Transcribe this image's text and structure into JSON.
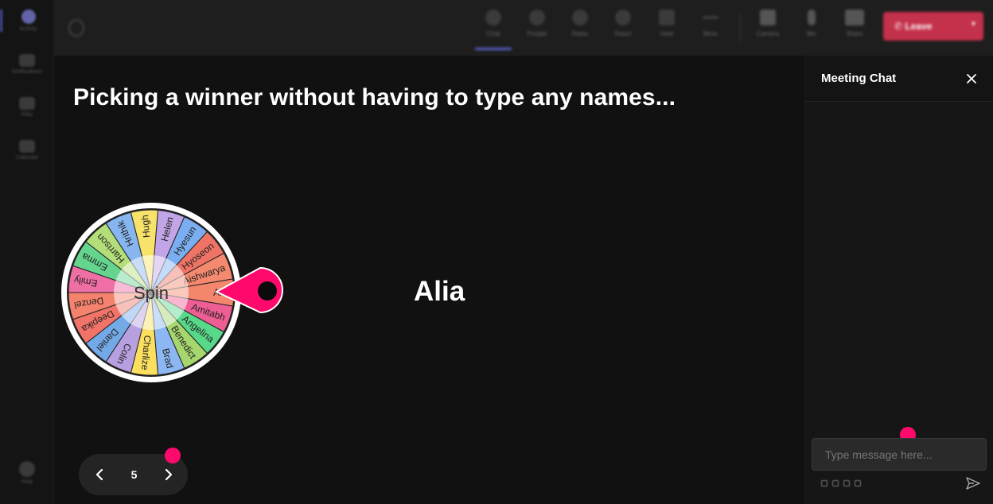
{
  "rail": {
    "items": [
      {
        "label": "Activity",
        "icon": "bell-icon"
      },
      {
        "label": "Notifications",
        "icon": "chat-icon"
      },
      {
        "label": "Files",
        "icon": "file-icon"
      },
      {
        "label": "Calendar",
        "icon": "calendar-icon"
      },
      {
        "label": "Help",
        "icon": "help-icon"
      }
    ]
  },
  "toolbar": {
    "buttons": [
      {
        "label": "Chat",
        "icon": "chat-bubble-icon"
      },
      {
        "label": "People",
        "icon": "people-icon"
      },
      {
        "label": "Raise",
        "icon": "hand-icon"
      },
      {
        "label": "React",
        "icon": "smile-icon"
      },
      {
        "label": "View",
        "icon": "grid-icon"
      },
      {
        "label": "More",
        "icon": "ellipsis-icon"
      },
      {
        "label": "Camera",
        "icon": "camera-icon"
      },
      {
        "label": "Mic",
        "icon": "mic-icon"
      },
      {
        "label": "Share",
        "icon": "share-icon"
      }
    ],
    "leave_label": "Leave",
    "leave_color": "#c4314b"
  },
  "stage": {
    "title": "Picking a winner without having to type any names...",
    "winner": "Alia",
    "wheel": {
      "center_label": "Spin",
      "names": [
        "Alia",
        "Amitabh",
        "Angelina",
        "Benedict",
        "Brad",
        "Charlize",
        "Colin",
        "Daniel",
        "Deepika",
        "Denzel",
        "Emily",
        "Emma",
        "Harrison",
        "Hrithik",
        "Hugh",
        "Helen",
        "Hyesun",
        "Hyoseon",
        "Aishwarya"
      ],
      "colors": [
        "#f4866d",
        "#ee5d93",
        "#58d889",
        "#a6d66e",
        "#8cb7f2",
        "#fbe060",
        "#b7a0e0",
        "#74a9e8",
        "#f27468",
        "#f5826c",
        "#ef6ea4",
        "#65d48e",
        "#b3de79",
        "#86b5ef",
        "#f7e36a",
        "#c1a5e6",
        "#7aaef0",
        "#f07466",
        "#f5896f"
      ],
      "pointer_color": "#ff0a6c"
    },
    "slide_nav": {
      "page": "5"
    },
    "accent": "#ff0a6c"
  },
  "chat": {
    "title": "Meeting Chat",
    "input_placeholder": "Type message here..."
  }
}
